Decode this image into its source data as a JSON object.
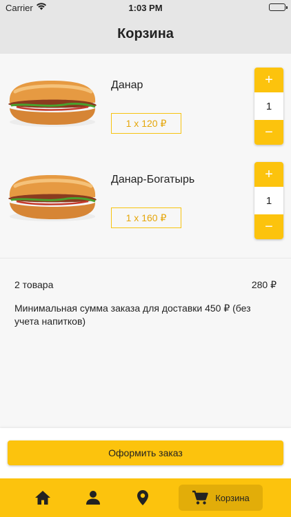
{
  "status_bar": {
    "carrier": "Carrier",
    "time": "1:03 PM"
  },
  "header": {
    "title": "Корзина"
  },
  "cart": {
    "items": [
      {
        "name": "Данар",
        "price_label": "1 x 120 ₽",
        "quantity": "1",
        "plus_label": "+",
        "minus_label": "−"
      },
      {
        "name": "Данар-Богатырь",
        "price_label": "1 x 160 ₽",
        "quantity": "1",
        "plus_label": "+",
        "minus_label": "−"
      }
    ]
  },
  "summary": {
    "count_label": "2 товара",
    "total": "280 ₽",
    "note": "Минимальная сумма заказа для доставки 450 ₽ (без учета напитков)"
  },
  "checkout": {
    "label": "Оформить заказ"
  },
  "tab_bar": {
    "tabs": [
      {
        "icon": "home-icon"
      },
      {
        "icon": "person-icon"
      },
      {
        "icon": "location-pin-icon"
      },
      {
        "icon": "cart-icon",
        "label": "Корзина",
        "active": true
      }
    ]
  },
  "colors": {
    "accent": "#fcc30d",
    "accent_dark": "#e2ad09",
    "price_text": "#e5a60a"
  }
}
